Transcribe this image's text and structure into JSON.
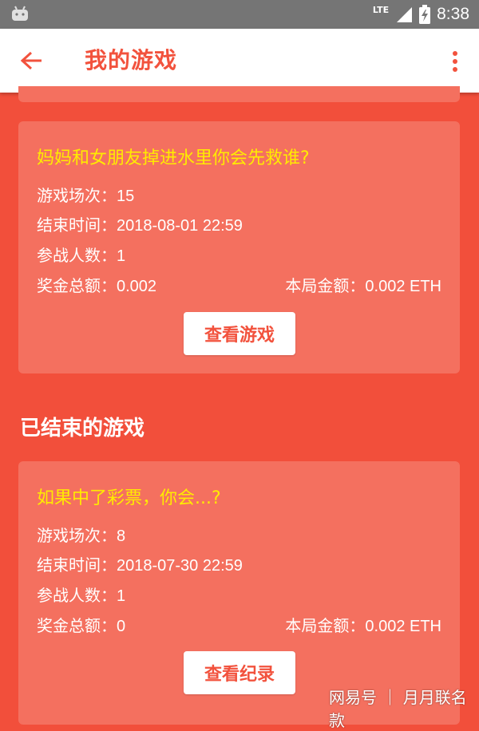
{
  "status_bar": {
    "network": "LTE",
    "time": "8:38"
  },
  "toolbar": {
    "title": "我的游戏"
  },
  "cards": [
    {
      "title": "妈妈和女朋友掉进水里你会先救谁?",
      "session_label": "游戏场次：",
      "session_value": "15",
      "end_label": "结束时间：",
      "end_value": "2018-08-01 22:59",
      "players_label": "参战人数：",
      "players_value": "1",
      "prize_label": "奖金总额：",
      "prize_value": "0.002",
      "round_label": "本局金额：",
      "round_value": "0.002 ETH",
      "button": "查看游戏"
    },
    {
      "title": "如果中了彩票，你会...?",
      "session_label": "游戏场次：",
      "session_value": "8",
      "end_label": "结束时间：",
      "end_value": "2018-07-30 22:59",
      "players_label": "参战人数：",
      "players_value": "1",
      "prize_label": "奖金总额：",
      "prize_value": "0",
      "round_label": "本局金额：",
      "round_value": "0.002 ETH",
      "button": "查看纪录"
    }
  ],
  "section": {
    "ended_heading": "已结束的游戏"
  },
  "watermark": "网易号 ｜ 月月联名款",
  "colors": {
    "background": "#f24f3b",
    "card": "#f4705f",
    "title_yellow": "#ffeb00",
    "accent": "#f2523d"
  }
}
